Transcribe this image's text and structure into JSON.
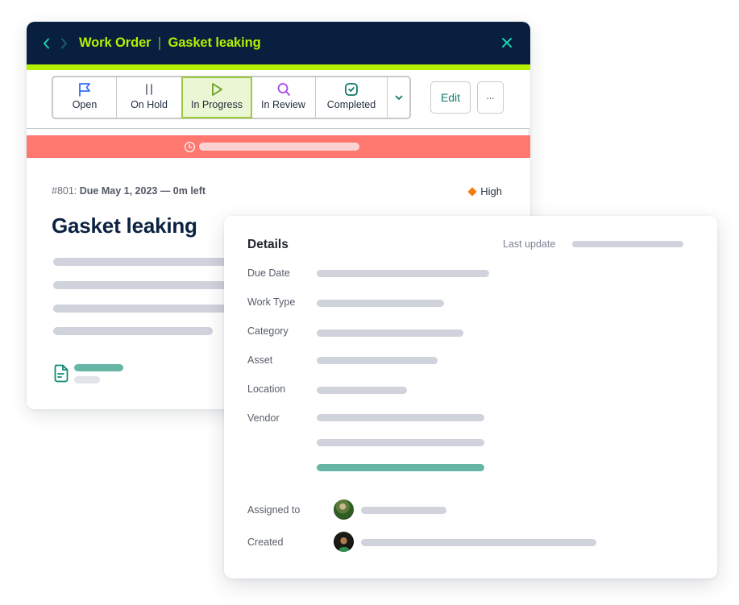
{
  "work_order_card": {
    "breadcrumb": {
      "back_icon": "chevron-left-icon",
      "forward_icon": "chevron-right-icon",
      "section": "Work Order",
      "title": "Gasket leaking",
      "close_icon": "close-icon"
    },
    "status_buttons": [
      {
        "label": "Open",
        "icon": "flag-icon",
        "active": false
      },
      {
        "label": "On Hold",
        "icon": "pause-icon",
        "active": false
      },
      {
        "label": "In Progress",
        "icon": "play-icon",
        "active": true
      },
      {
        "label": "In Review",
        "icon": "search-icon",
        "active": false
      },
      {
        "label": "Completed",
        "icon": "check-square-icon",
        "active": false
      }
    ],
    "status_more_icon": "chevron-down-icon",
    "edit_label": "Edit",
    "more_label": "...",
    "timer_icon": "clock-icon",
    "id_label": "#801:",
    "due_text": "Due May 1, 2023 — 0m left",
    "priority": "High",
    "title": "Gasket leaking",
    "attachment_icon": "document-icon"
  },
  "details_card": {
    "title": "Details",
    "last_update_label": "Last update",
    "fields": [
      {
        "label": "Due Date"
      },
      {
        "label": "Work Type"
      },
      {
        "label": "Category"
      },
      {
        "label": "Asset"
      },
      {
        "label": "Location"
      },
      {
        "label": "Vendor"
      }
    ],
    "assigned_label": "Assigned to",
    "created_label": "Created"
  },
  "colors": {
    "header_bg": "#081f3f",
    "accent_lime": "#b6f000",
    "teal": "#0f7a6e",
    "timer_red": "#ff7870",
    "priority_high": "#f77b0c",
    "in_progress_bg": "#ebf6d4",
    "skeleton": "#d0d2dc",
    "skeleton_teal": "#66b5a5"
  }
}
